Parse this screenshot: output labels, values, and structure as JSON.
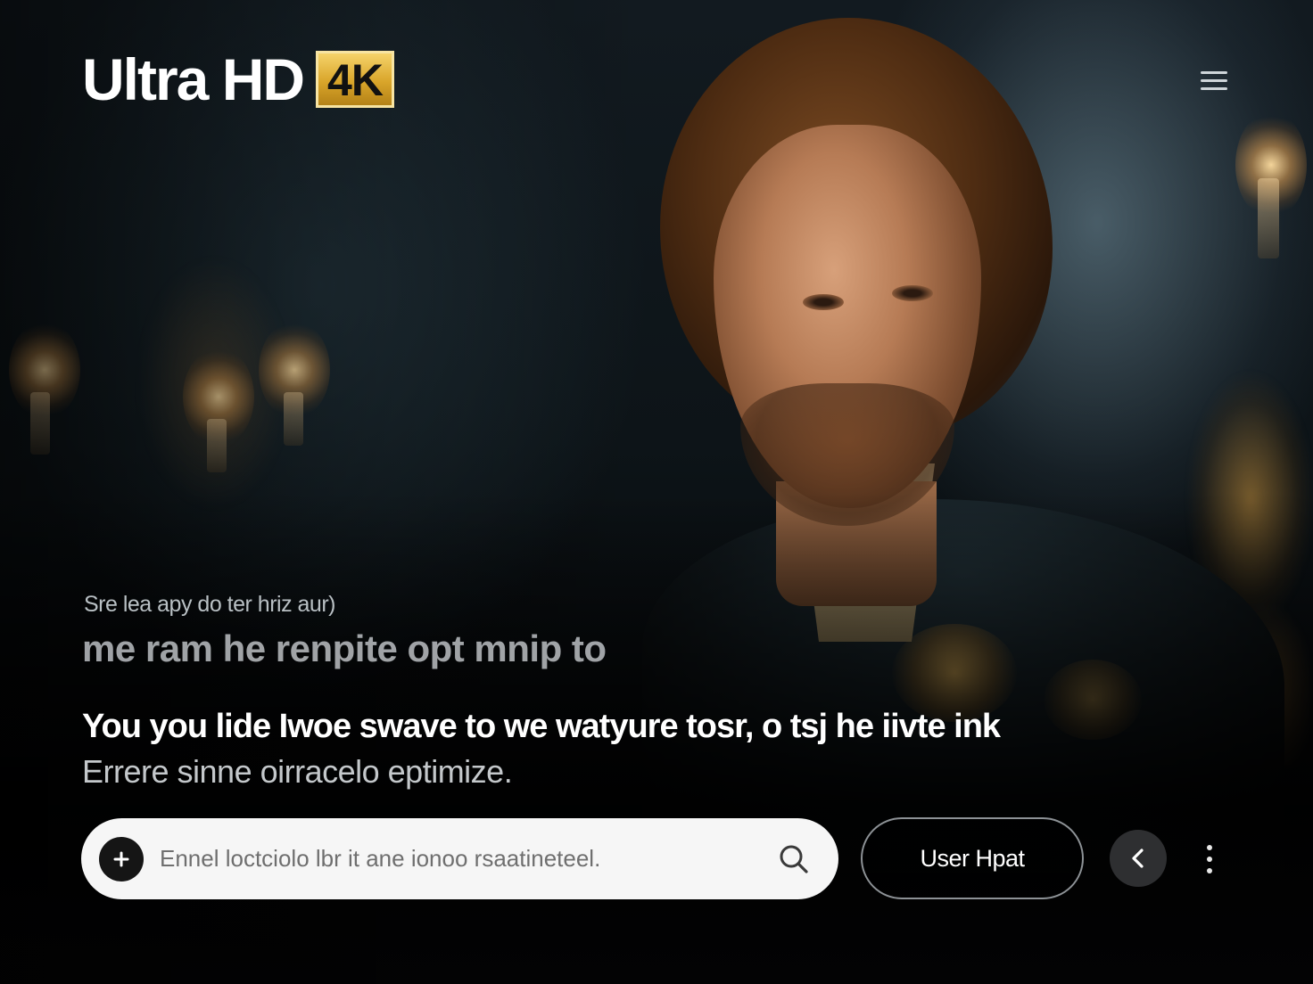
{
  "header": {
    "logo_text": "Ultra HD",
    "badge_text": "4K",
    "menu_icon": "hamburger-menu-icon"
  },
  "hero": {
    "eyebrow": "Sre lea apy do ter hriz aur)",
    "headline_faded": "me ram he renpite opt mnip to",
    "headline": "You you lide Iwoe swave to we watyure tosr, o tsj he iivte ink",
    "subline": "Errere sinne oirracelo eptimize."
  },
  "search": {
    "placeholder": "Ennel loctciolo lbr it ane ionoo rsaatineteel.",
    "value": "",
    "add_icon": "plus-icon",
    "search_icon": "search-icon"
  },
  "controls": {
    "user_button_label": "User Hpat",
    "back_icon": "chevron-left-icon",
    "more_icon": "more-vertical-icon"
  },
  "colors": {
    "accent_gold": "#d9a52a",
    "text_primary": "#ffffff",
    "search_bg": "#f6f6f6"
  }
}
